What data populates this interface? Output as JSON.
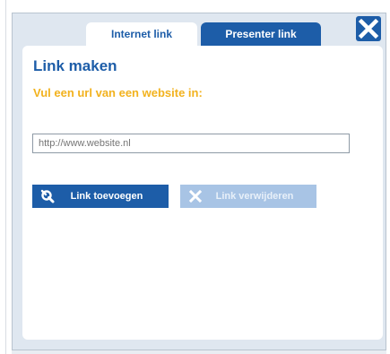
{
  "tabs": {
    "internet_label": "Internet link",
    "presenter_label": "Presenter link"
  },
  "panel": {
    "title": "Link maken",
    "subtitle": "Vul een url van een website in:",
    "url_placeholder": "http://www.website.nl"
  },
  "buttons": {
    "add_label": "Link toevoegen",
    "remove_label": "Link verwijderen"
  },
  "colors": {
    "accent": "#1d5da8",
    "highlight": "#f2b21e",
    "disabled": "#a8c4e5"
  },
  "icons": {
    "close": "close-icon",
    "add": "link-icon",
    "remove": "x-icon"
  }
}
